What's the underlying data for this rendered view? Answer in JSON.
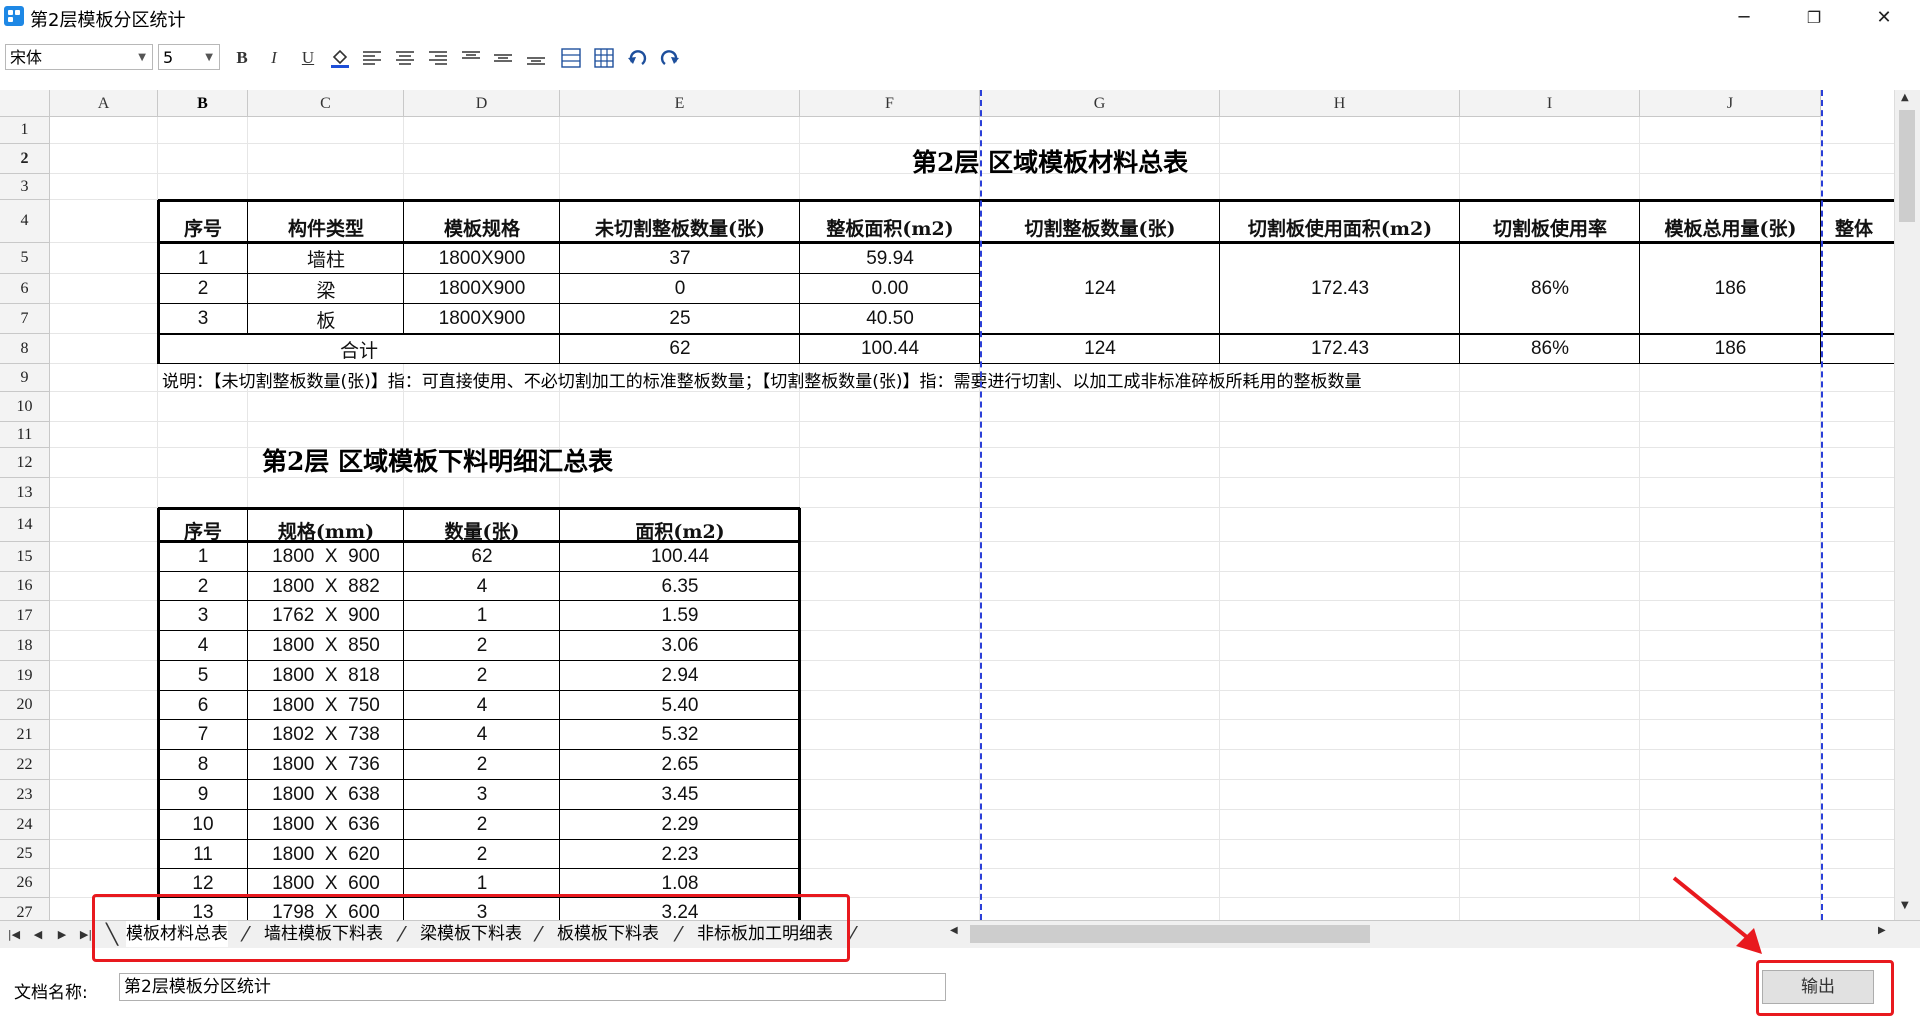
{
  "window": {
    "title": "第2层模板分区统计"
  },
  "toolbar": {
    "font_name": "宋体",
    "font_size": "5",
    "bold": "B",
    "italic": "I",
    "underline": "U"
  },
  "columns": [
    "A",
    "B",
    "C",
    "D",
    "E",
    "F",
    "G",
    "H",
    "I",
    "J"
  ],
  "rows": [
    "1",
    "2",
    "3",
    "4",
    "5",
    "6",
    "7",
    "8",
    "9",
    "10",
    "11",
    "12",
    "13",
    "14",
    "15",
    "16",
    "17",
    "18",
    "19",
    "20",
    "21",
    "22",
    "23",
    "24",
    "25",
    "26",
    "27"
  ],
  "summary": {
    "title": "第2层  区域模板材料总表",
    "headers": [
      "序号",
      "构件类型",
      "模板规格",
      "未切割整板数量(张)",
      "整板面积(m2)",
      "切割整板数量(张)",
      "切割板使用面积(m2)",
      "切割板使用率",
      "模板总用量(张)",
      "整体"
    ],
    "rows": [
      [
        "1",
        "墙柱",
        "1800X900",
        "37",
        "59.94"
      ],
      [
        "2",
        "梁",
        "1800X900",
        "0",
        "0.00"
      ],
      [
        "3",
        "板",
        "1800X900",
        "25",
        "40.50"
      ]
    ],
    "merged": {
      "cut_count": "124",
      "cut_area": "172.43",
      "usage": "86%",
      "total": "186"
    },
    "total_row": {
      "label": "合计",
      "uncut": "62",
      "area": "100.44",
      "cut_count": "124",
      "cut_area": "172.43",
      "usage": "86%",
      "total": "186"
    },
    "note": "说明：【未切割整板数量(张)】指：可直接使用、不必切割加工的标准整板数量；【切割整板数量(张)】指：需要进行切割、以加工成非标准碎板所耗用的整板数量"
  },
  "detail": {
    "title": "第2层  区域模板下料明细汇总表",
    "headers": [
      "序号",
      "规格(mm)",
      "数量(张)",
      "面积(m2)"
    ],
    "rows": [
      [
        "1",
        "1800  X  900",
        "62",
        "100.44"
      ],
      [
        "2",
        "1800  X  882",
        "4",
        "6.35"
      ],
      [
        "3",
        "1762  X  900",
        "1",
        "1.59"
      ],
      [
        "4",
        "1800  X  850",
        "2",
        "3.06"
      ],
      [
        "5",
        "1800  X  818",
        "2",
        "2.94"
      ],
      [
        "6",
        "1800  X  750",
        "4",
        "5.40"
      ],
      [
        "7",
        "1802  X  738",
        "4",
        "5.32"
      ],
      [
        "8",
        "1800  X  736",
        "2",
        "2.65"
      ],
      [
        "9",
        "1800  X  638",
        "3",
        "3.45"
      ],
      [
        "10",
        "1800  X  636",
        "2",
        "2.29"
      ],
      [
        "11",
        "1800  X  620",
        "2",
        "2.23"
      ],
      [
        "12",
        "1800  X  600",
        "1",
        "1.08"
      ],
      [
        "13",
        "1798  X  600",
        "3",
        "3.24"
      ]
    ]
  },
  "sheet_tabs": [
    "模板材料总表",
    "墙柱模板下料表",
    "梁模板下料表",
    "板模板下料表",
    "非标板加工明细表"
  ],
  "footer": {
    "doc_label": "文档名称:",
    "doc_name": "第2层模板分区统计",
    "output_label": "输出"
  },
  "colors": {
    "annotation": "#e8191e",
    "page_break": "#2b3fd8"
  }
}
